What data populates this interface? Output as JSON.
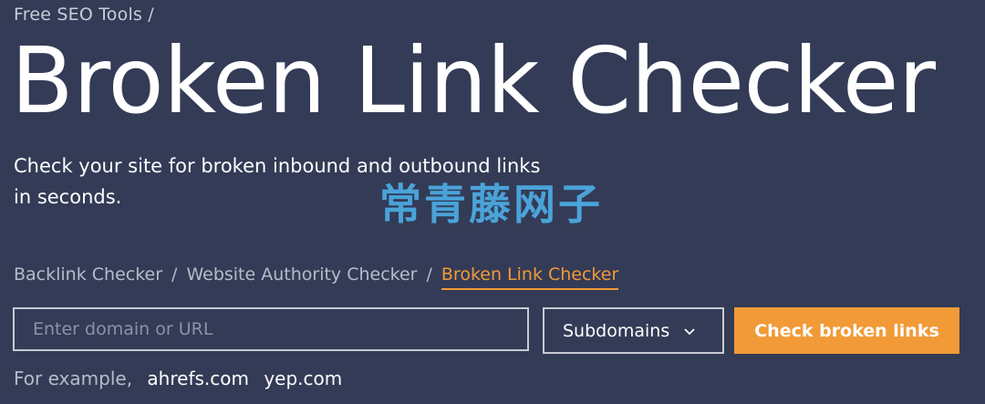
{
  "breadcrumb": {
    "text": "Free SEO Tools /"
  },
  "title": "Broken Link Checker",
  "subtitle": {
    "line1": "Check your site for broken inbound and outbound links",
    "line2": "in seconds."
  },
  "watermark": "常青藤网子",
  "tool_nav": {
    "items": [
      {
        "label": "Backlink Checker"
      },
      {
        "label": "Website Authority Checker"
      },
      {
        "label": "Broken Link Checker",
        "active": true
      }
    ],
    "separator": "/"
  },
  "search": {
    "placeholder": "Enter domain or URL",
    "value": ""
  },
  "scope_select": {
    "selected": "Subdomains",
    "icon": "chevron-down-icon"
  },
  "submit": {
    "label": "Check broken links"
  },
  "examples": {
    "prefix": "For example,",
    "items": [
      "ahrefs.com",
      "yep.com"
    ]
  },
  "colors": {
    "background": "#333b56",
    "accent": "#f29a37",
    "muted_text": "#b7bcca",
    "watermark": "#4aa3d9"
  }
}
